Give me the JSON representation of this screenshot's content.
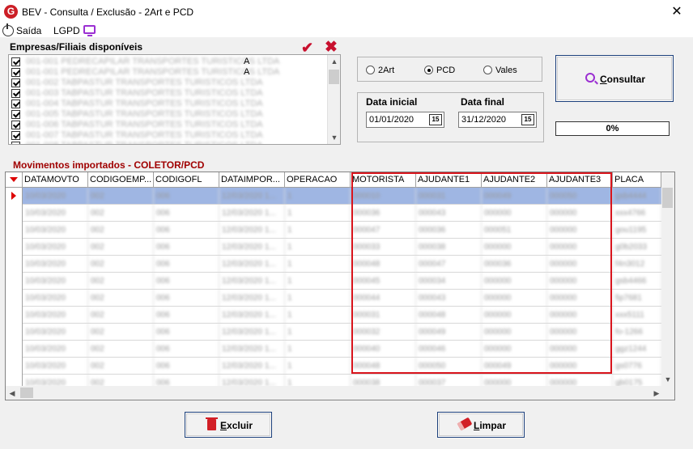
{
  "window": {
    "title": "BEV - Consulta / Exclusão - 2Art e PCD",
    "app_icon_letter": "G",
    "close_symbol": "✕"
  },
  "menu": {
    "exit_label": "Saída",
    "lgpd_label": "LGPD",
    "exit_icon": "exit-icon",
    "lgpd_icon": "monitor-icon"
  },
  "companies": {
    "label": "Empresas/Filiais disponíveis",
    "check_all_icon": "check-icon",
    "uncheck_all_icon": "cross-icon",
    "items": [
      {
        "name": "001-001 PEDRECAPILAR TRANSPORTES TURISTICOS LTDA",
        "tail": "A",
        "checked": true
      },
      {
        "name": "001-001 PEDRECAPILAR TRANSPORTES TURISTICOS LTDA",
        "tail": "A",
        "checked": true
      },
      {
        "name": "001-002 TABPASTUR TRANSPORTES TURISTICOS LTDA",
        "tail": "",
        "checked": true
      },
      {
        "name": "001-003 TABPASTUR TRANSPORTES TURISTICOS LTDA",
        "tail": "",
        "checked": true
      },
      {
        "name": "001-004 TABPASTUR TRANSPORTES TURISTICOS LTDA",
        "tail": "",
        "checked": true
      },
      {
        "name": "001-005 TABPASTUR TRANSPORTES TURISTICOS LTDA",
        "tail": "",
        "checked": true
      },
      {
        "name": "001-006 TABPASTUR TRANSPORTES TURISTICOS LTDA",
        "tail": "",
        "checked": true
      },
      {
        "name": "001-007 TABPASTUR TRANSPORTES TURISTICOS LTDA",
        "tail": "",
        "checked": true
      },
      {
        "name": "001-008 TABPASTUR TRANSPORTES TURISTICOS LTDA",
        "tail": "",
        "checked": true
      }
    ]
  },
  "options": {
    "radios": [
      {
        "label": "2Art",
        "selected": false
      },
      {
        "label": "PCD",
        "selected": true
      },
      {
        "label": "Vales",
        "selected": false
      }
    ]
  },
  "dates": {
    "start_label": "Data inicial",
    "start_value": "01/01/2020",
    "end_label": "Data final",
    "end_value": "31/12/2020",
    "calendar_icon_text": "15"
  },
  "consult_button": {
    "label": "Consultar",
    "icon": "search-icon"
  },
  "progress": {
    "text": "0%",
    "value": 0
  },
  "movements": {
    "label": "Movimentos importados - COLETOR/PCD",
    "columns": [
      "DATAMOVTO",
      "CODIGOEMP...",
      "CODIGOFL",
      "DATAIMPOR...",
      "OPERACAO",
      "MOTORISTA",
      "AJUDANTE1",
      "AJUDANTE2",
      "AJUDANTE3",
      "PLACA"
    ],
    "rows": [
      [
        "10/03/2020",
        "002",
        "006",
        "12/03/2020 1...",
        "1",
        "000010",
        "000031",
        "000049",
        "000050",
        "gsb4444"
      ],
      [
        "10/03/2020",
        "002",
        "006",
        "12/03/2020 1...",
        "1",
        "000036",
        "000043",
        "000000",
        "000000",
        "xxx4766"
      ],
      [
        "10/03/2020",
        "002",
        "006",
        "12/03/2020 1...",
        "1",
        "000047",
        "000036",
        "000051",
        "000000",
        "gou1195"
      ],
      [
        "10/03/2020",
        "002",
        "006",
        "12/03/2020 1...",
        "1",
        "000033",
        "000038",
        "000000",
        "000000",
        "g0b2033"
      ],
      [
        "10/03/2020",
        "002",
        "006",
        "12/03/2020 1...",
        "1",
        "000048",
        "000047",
        "000036",
        "000000",
        "f4n3012"
      ],
      [
        "10/03/2020",
        "002",
        "006",
        "12/03/2020 1...",
        "1",
        "000045",
        "000034",
        "000000",
        "000000",
        "gsb4466"
      ],
      [
        "10/03/2020",
        "002",
        "006",
        "12/03/2020 1...",
        "1",
        "000044",
        "000043",
        "000000",
        "000000",
        "fip7681"
      ],
      [
        "10/03/2020",
        "002",
        "006",
        "12/03/2020 1...",
        "1",
        "000031",
        "000048",
        "000000",
        "000000",
        "xxx5111"
      ],
      [
        "10/03/2020",
        "002",
        "006",
        "12/03/2020 1...",
        "1",
        "000032",
        "000049",
        "000000",
        "000000",
        "fo-1266"
      ],
      [
        "10/03/2020",
        "002",
        "006",
        "12/03/2020 1...",
        "1",
        "000040",
        "000046",
        "000000",
        "000000",
        "ggz1244"
      ],
      [
        "10/03/2020",
        "002",
        "006",
        "12/03/2020 1...",
        "1",
        "000048",
        "000050",
        "000049",
        "000000",
        "gs0776"
      ],
      [
        "10/03/2020",
        "002",
        "006",
        "12/03/2020 1...",
        "1",
        "000038",
        "000037",
        "000000",
        "000000",
        "gb0175"
      ]
    ]
  },
  "footer": {
    "delete_label": "Excluir",
    "delete_icon": "trash-icon",
    "clear_label": "Limpar",
    "clear_icon": "eraser-icon"
  },
  "colors": {
    "accent_red": "#c8102e",
    "selection_blue": "#9fb6e3",
    "highlight_red": "#d9141c",
    "icon_purple": "#9b2fd2"
  }
}
